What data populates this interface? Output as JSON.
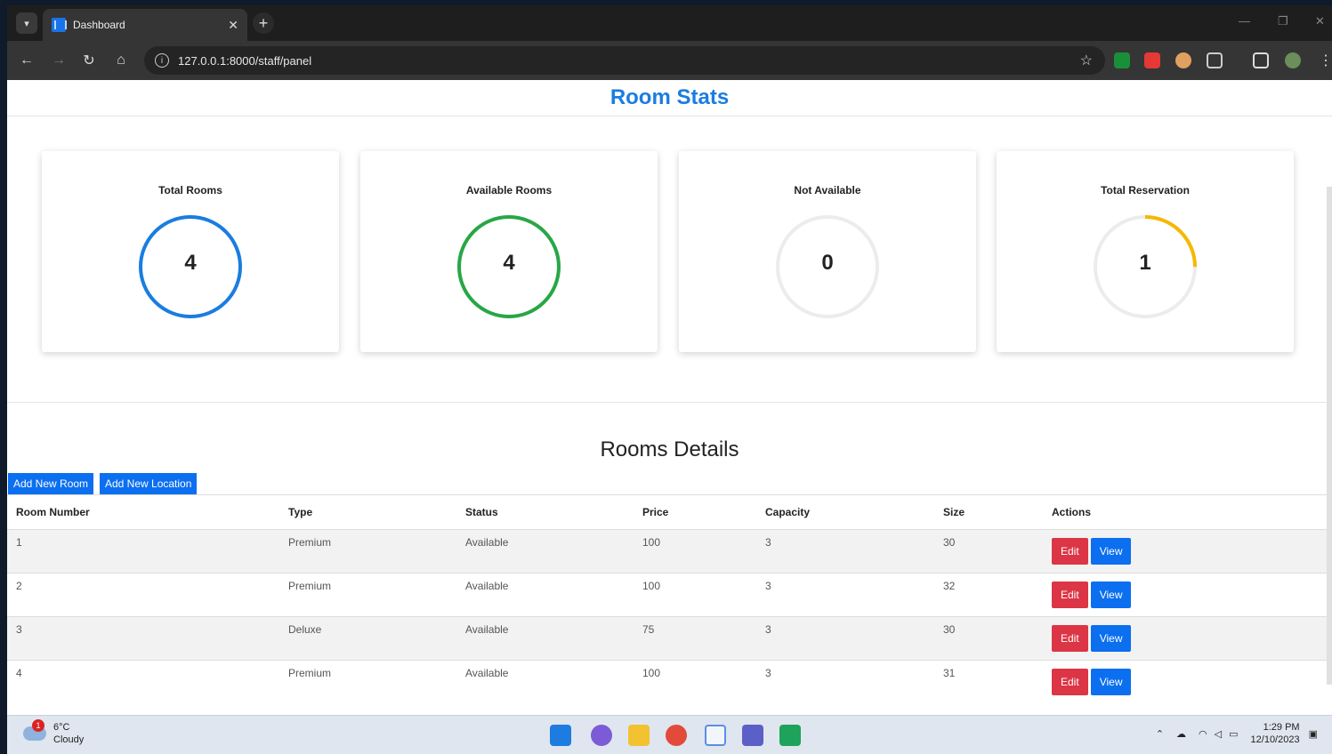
{
  "browser": {
    "tab_title": "Dashboard",
    "url": "127.0.0.1:8000/staff/panel"
  },
  "stats": {
    "title": "Room Stats",
    "cards": [
      {
        "label": "Total Rooms",
        "value": "4",
        "color": "#1a7de0",
        "fraction": 1.0
      },
      {
        "label": "Available Rooms",
        "value": "4",
        "color": "#28a745",
        "fraction": 1.0
      },
      {
        "label": "Not Available",
        "value": "0",
        "color": "#e8e8e8",
        "fraction": 0.0
      },
      {
        "label": "Total Reservation",
        "value": "1",
        "color": "#f5b800",
        "fraction": 0.25
      }
    ]
  },
  "details": {
    "title": "Rooms Details",
    "add_room_label": "Add New Room",
    "add_location_label": "Add New Location",
    "columns": [
      "Room Number",
      "Type",
      "Status",
      "Price",
      "Capacity",
      "Size",
      "Actions"
    ],
    "rows": [
      {
        "number": "1",
        "type": "Premium",
        "status": "Available",
        "price": "100",
        "capacity": "3",
        "size": "30"
      },
      {
        "number": "2",
        "type": "Premium",
        "status": "Available",
        "price": "100",
        "capacity": "3",
        "size": "32"
      },
      {
        "number": "3",
        "type": "Deluxe",
        "status": "Available",
        "price": "75",
        "capacity": "3",
        "size": "30"
      },
      {
        "number": "4",
        "type": "Premium",
        "status": "Available",
        "price": "100",
        "capacity": "3",
        "size": "31"
      }
    ],
    "edit_label": "Edit",
    "view_label": "View"
  },
  "taskbar": {
    "weather_temp": "6°C",
    "weather_desc": "Cloudy",
    "weather_badge": "1",
    "time": "1:29 PM",
    "date": "12/10/2023"
  }
}
